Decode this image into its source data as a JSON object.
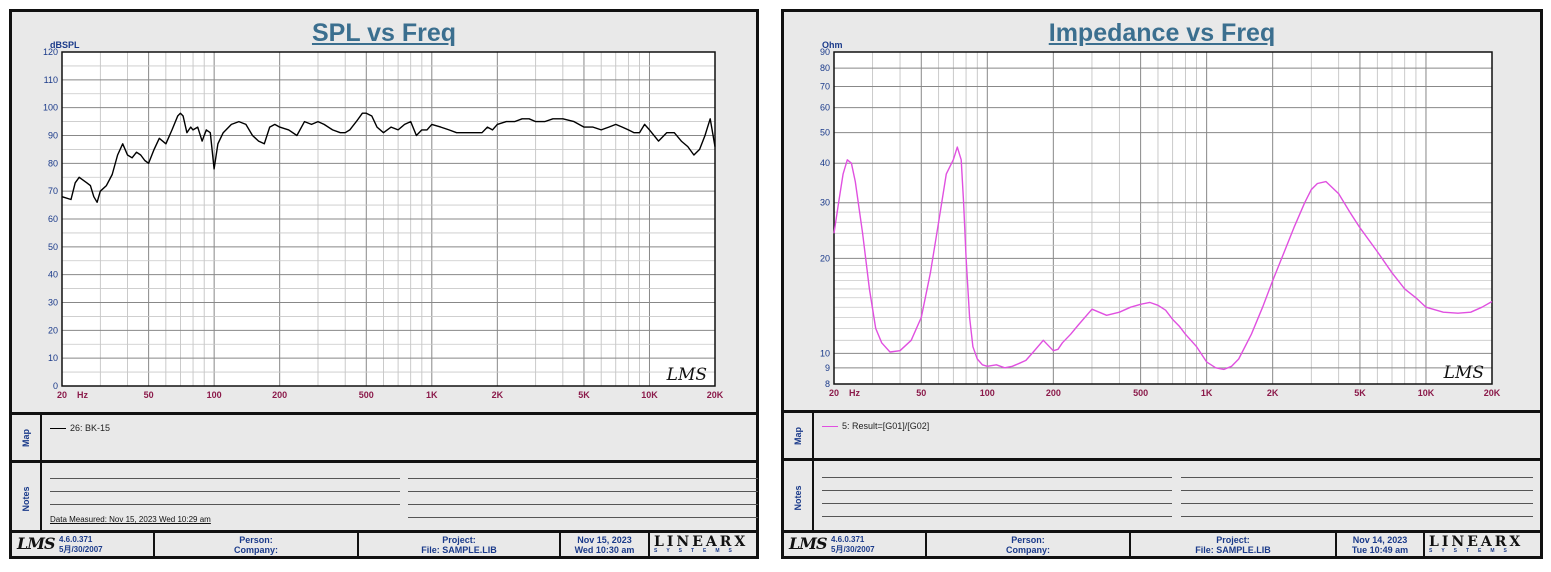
{
  "panels": [
    {
      "title": "SPL vs Freq",
      "map_label": "Map",
      "notes_label": "Notes",
      "map_entry": "26: BK-15",
      "data_measured": "Data Measured: Nov 15, 2023  Wed 10:29 am",
      "footer": {
        "logo": "LMS",
        "version": "4.6.0.371",
        "version_date": "5月/30/2007",
        "person": "Person:",
        "company": "Company:",
        "project": "Project:",
        "file": "File: SAMPLE.LIB",
        "date": "Nov 15, 2023",
        "time": "Wed 10:30 am",
        "brand": "LINEARX",
        "brand_sub": "SYSTEMS"
      }
    },
    {
      "title": "Impedance vs Freq",
      "map_label": "Map",
      "notes_label": "Notes",
      "map_entry": "5: Result=[G01]/[G02]",
      "data_measured": "",
      "footer": {
        "logo": "LMS",
        "version": "4.6.0.371",
        "version_date": "5月/30/2007",
        "person": "Person:",
        "company": "Company:",
        "project": "Project:",
        "file": "File: SAMPLE.LIB",
        "date": "Nov 14, 2023",
        "time": "Tue 10:49 am",
        "brand": "LINEARX",
        "brand_sub": "SYSTEMS"
      }
    }
  ],
  "chart_data": [
    {
      "type": "line",
      "title": "SPL vs Freq",
      "ylabel": "dBSPL",
      "xlabel": "Hz",
      "x_scale": "log",
      "xlim": [
        20,
        20000
      ],
      "ylim": [
        0,
        120
      ],
      "yticks": [
        0,
        10,
        20,
        30,
        40,
        50,
        60,
        70,
        80,
        90,
        100,
        110,
        120
      ],
      "xticks": [
        20,
        50,
        100,
        200,
        500,
        1000,
        2000,
        5000,
        10000,
        20000
      ],
      "xtick_labels": [
        "20",
        "50",
        "100",
        "200",
        "500",
        "1K",
        "2K",
        "5K",
        "10K",
        "20K"
      ],
      "watermark": "LMS",
      "grid": true,
      "series": [
        {
          "name": "26: BK-15",
          "color": "#000000",
          "x": [
            20,
            22,
            23,
            24,
            26,
            27,
            28,
            29,
            30,
            32,
            34,
            36,
            38,
            40,
            42,
            44,
            46,
            48,
            50,
            53,
            56,
            60,
            64,
            68,
            70,
            72,
            75,
            78,
            80,
            84,
            88,
            92,
            96,
            100,
            104,
            110,
            120,
            130,
            140,
            150,
            160,
            170,
            180,
            190,
            200,
            220,
            240,
            260,
            280,
            300,
            320,
            350,
            380,
            400,
            420,
            450,
            480,
            500,
            530,
            560,
            600,
            650,
            700,
            750,
            800,
            850,
            900,
            950,
            1000,
            1100,
            1200,
            1300,
            1500,
            1700,
            1800,
            1900,
            2000,
            2200,
            2400,
            2600,
            2800,
            3000,
            3300,
            3600,
            4000,
            4500,
            5000,
            5500,
            6000,
            6500,
            7000,
            7500,
            8000,
            8500,
            9000,
            9500,
            10000,
            11000,
            12000,
            13000,
            14000,
            15000,
            16000,
            17000,
            18000,
            18500,
            19000,
            20000
          ],
          "y": [
            68,
            67,
            73,
            75,
            73,
            72,
            68,
            66,
            70,
            72,
            76,
            83,
            87,
            83,
            82,
            84,
            83,
            81,
            80,
            85,
            89,
            87,
            92,
            97,
            98,
            97,
            91,
            93,
            92,
            93,
            88,
            92,
            91,
            78,
            87,
            91,
            94,
            95,
            94,
            90,
            88,
            87,
            93,
            94,
            93,
            92,
            90,
            95,
            94,
            95,
            94,
            92,
            91,
            91,
            92,
            95,
            98,
            98,
            97,
            93,
            91,
            93,
            92,
            94,
            95,
            90,
            92,
            92,
            94,
            93,
            92,
            91,
            91,
            91,
            93,
            92,
            94,
            95,
            95,
            96,
            96,
            95,
            95,
            96,
            96,
            95,
            93,
            93,
            92,
            93,
            94,
            93,
            92,
            91,
            91,
            94,
            92,
            88,
            91,
            91,
            88,
            86,
            83,
            85,
            90,
            93,
            96,
            86
          ]
        }
      ]
    },
    {
      "type": "line",
      "title": "Impedance vs Freq",
      "ylabel": "Ohm",
      "xlabel": "Hz",
      "x_scale": "log",
      "y_scale": "log",
      "xlim": [
        20,
        20000
      ],
      "ylim": [
        8,
        90
      ],
      "yticks": [
        8,
        9,
        10,
        20,
        30,
        40,
        50,
        60,
        70,
        80,
        90
      ],
      "xticks": [
        20,
        50,
        100,
        200,
        500,
        1000,
        2000,
        5000,
        10000,
        20000
      ],
      "xtick_labels": [
        "20",
        "50",
        "100",
        "200",
        "500",
        "1K",
        "2K",
        "5K",
        "10K",
        "20K"
      ],
      "watermark": "LMS",
      "grid": true,
      "series": [
        {
          "name": "5: Result=[G01]/[G02]",
          "color": "#e050e0",
          "x": [
            20,
            21,
            22,
            23,
            24,
            25,
            27,
            29,
            31,
            33,
            36,
            40,
            45,
            50,
            55,
            60,
            65,
            70,
            73,
            76,
            78,
            80,
            83,
            86,
            90,
            95,
            100,
            110,
            120,
            130,
            140,
            150,
            160,
            180,
            200,
            210,
            220,
            240,
            260,
            300,
            350,
            400,
            450,
            500,
            550,
            600,
            650,
            700,
            750,
            800,
            900,
            1000,
            1100,
            1200,
            1300,
            1400,
            1600,
            1800,
            2000,
            2200,
            2500,
            2800,
            3000,
            3200,
            3500,
            4000,
            4500,
            5000,
            6000,
            7000,
            8000,
            9000,
            10000,
            12000,
            14000,
            16000,
            18000,
            20000
          ],
          "y": [
            24,
            30,
            37,
            41,
            40,
            35,
            24,
            16,
            12,
            10.8,
            10.1,
            10.2,
            11,
            13,
            18,
            26,
            37,
            41,
            45,
            41,
            30,
            20,
            13,
            10.5,
            9.6,
            9.2,
            9.1,
            9.2,
            9.0,
            9.1,
            9.3,
            9.5,
            10.0,
            11.0,
            10.2,
            10.3,
            10.8,
            11.5,
            12.3,
            13.8,
            13.2,
            13.5,
            14.0,
            14.3,
            14.5,
            14.2,
            13.7,
            12.8,
            12.2,
            11.5,
            10.5,
            9.4,
            9.0,
            8.9,
            9.1,
            9.6,
            11.5,
            14,
            17,
            20,
            25,
            30,
            33,
            34.5,
            35,
            32,
            28,
            25,
            21,
            18,
            16,
            15,
            14,
            13.5,
            13.4,
            13.5,
            14,
            14.6
          ]
        }
      ]
    }
  ]
}
